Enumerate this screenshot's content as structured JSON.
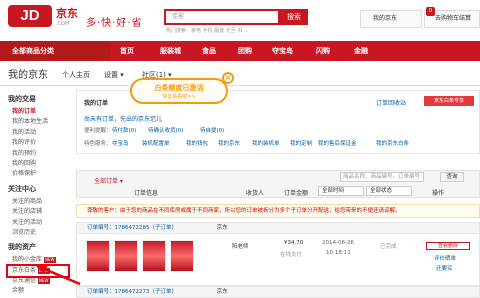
{
  "header": {
    "logo": "JD",
    "logo_cn": "京东",
    "logo_domain": ".COM",
    "slogan": "多·快·好·省",
    "search_placeholder": "佳能",
    "search_button": "搜索",
    "hot_words": "热门搜索：家电 手机 服装 元旦 书 ...",
    "my_jd": "我的京东",
    "cart": "去购物车结算",
    "cart_count": "0"
  },
  "nav": {
    "category": "全部商品分类",
    "items": [
      "首页",
      "服装城",
      "食品",
      "团购",
      "夺宝岛",
      "闪购",
      "金融"
    ]
  },
  "subheader": {
    "title": "我的京东",
    "links": [
      "个人主页",
      "设置 ▾",
      "社区(1) ▾"
    ]
  },
  "left_menu": {
    "sections": [
      {
        "title": "我的交易",
        "items": [
          "我的订单",
          "我的本地生活",
          "我的活动",
          "我的评价",
          "我的预约",
          "我的回购",
          "价格保护"
        ]
      },
      {
        "title": "关注中心",
        "items": [
          "关注的商品",
          "关注的店铺",
          "关注的活动",
          "浏览历史"
        ]
      },
      {
        "title": "我的资产",
        "items": [
          "我的小金库",
          "京东白条",
          "京东通信",
          "余额"
        ]
      }
    ],
    "active_item": "我的订单",
    "highlighted_item": "京东白条",
    "tag_text": "NEW"
  },
  "callout": {
    "title": "白条额度已激活",
    "subtitle": "快去看看吧>>",
    "close": "×"
  },
  "order_panel": {
    "title": "我的订单",
    "right_link": "订单回收站",
    "right_button": "京东白条专享",
    "line": "尚未有订单，先出的京东范儿",
    "status_rows": [
      [
        "便利提醒：",
        "待付款(0)",
        "待确认收货(0)",
        "待自提(0)"
      ],
      [
        "特色服务：",
        "夺宝岛",
        "装机配置单",
        "我的钱包",
        "我的京东"
      ]
    ],
    "service_links": [
      "我的装机单",
      "我的定制",
      "我的售后保证金",
      "我的京东白条"
    ]
  },
  "order_table": {
    "tab_all": "全部订单 ▾",
    "search_placeholder": "商品名称，商品编号，订单编号",
    "search_button": "查询",
    "columns": [
      "订单信息",
      "收货人",
      "订单金额",
      "全部时间",
      "全部状态",
      "操作"
    ],
    "notice": "尊敬的客户：由于您的商品在不同库房或属于不同商家，所以您的订单被拆分为多个子订单分开配送，给您带来的不便还请谅解。",
    "orders": [
      {
        "head": "订单编号：1786472285（子订单）",
        "shop": "京东",
        "receiver": "阳老师",
        "amount": "¥34.70",
        "pay": "在线支付",
        "date": "2014-08-26",
        "time": "10:18:11",
        "status": "已完成",
        "ops": [
          "查看删除",
          "评价晒单",
          "还要买"
        ]
      },
      {
        "head": "订单编号：1786472273（子订单）",
        "shop": "京东"
      }
    ]
  }
}
